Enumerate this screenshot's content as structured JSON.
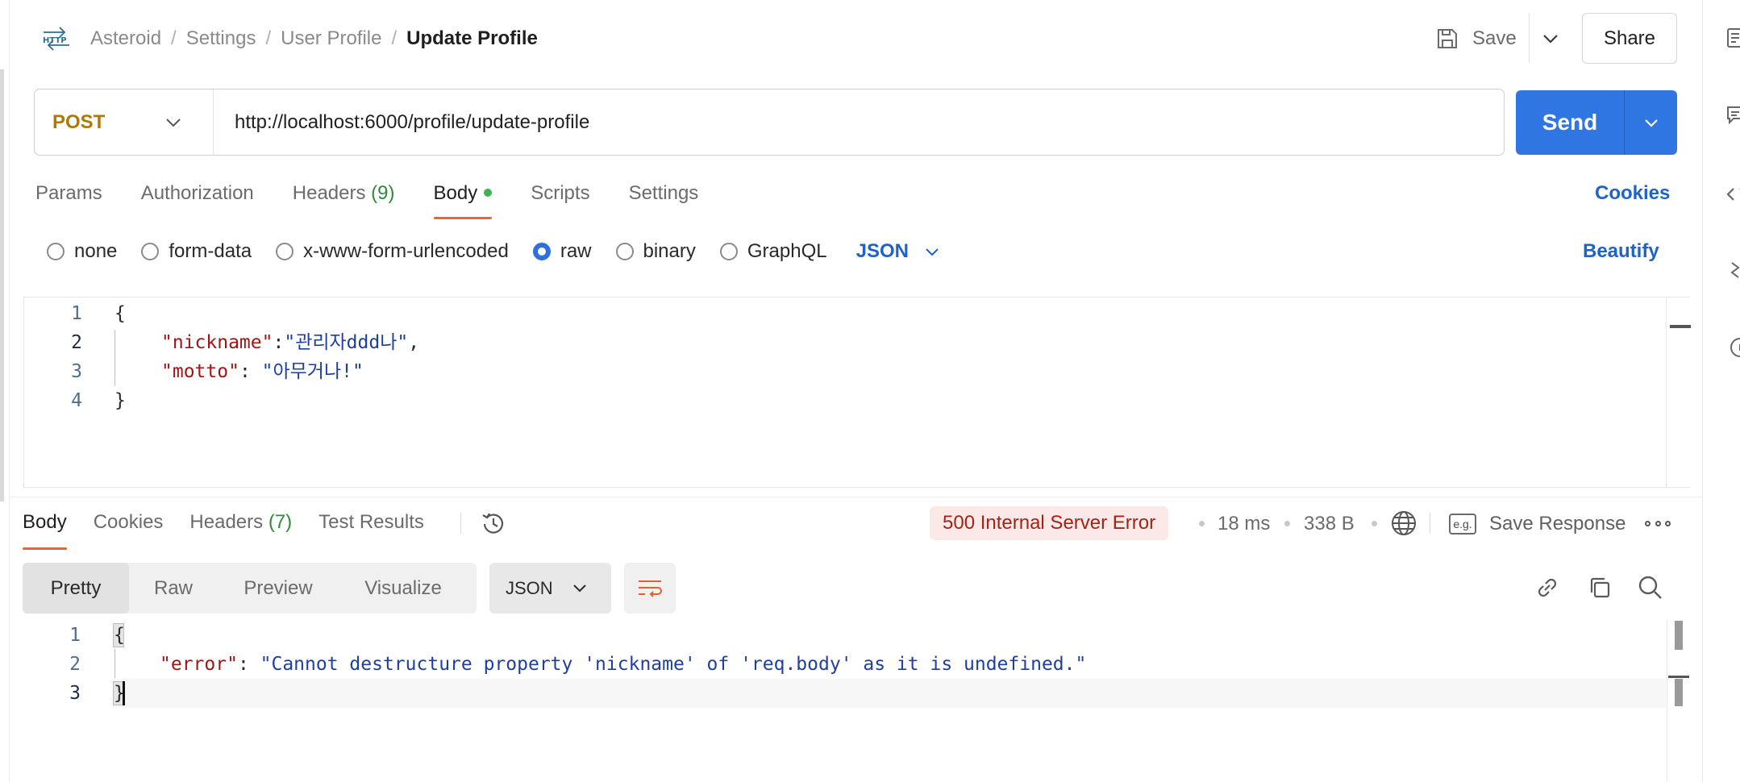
{
  "breadcrumb": {
    "items": [
      "Asteroid",
      "Settings",
      "User Profile"
    ],
    "current": "Update Profile"
  },
  "header": {
    "save_label": "Save",
    "share_label": "Share"
  },
  "request": {
    "method": "POST",
    "url": "http://localhost:6000/profile/update-profile",
    "send_label": "Send",
    "tabs": [
      {
        "label": "Params"
      },
      {
        "label": "Authorization"
      },
      {
        "label": "Headers",
        "count": "(9)"
      },
      {
        "label": "Body",
        "active": true
      },
      {
        "label": "Scripts"
      },
      {
        "label": "Settings"
      }
    ],
    "cookies_label": "Cookies",
    "body_types": [
      "none",
      "form-data",
      "x-www-form-urlencoded",
      "raw",
      "binary",
      "GraphQL"
    ],
    "selected_body_type": "raw",
    "format": "JSON",
    "beautify_label": "Beautify",
    "body_lines": {
      "n1": "1",
      "n2": "2",
      "n3": "3",
      "n4": "4",
      "open": "{",
      "k1": "\"nickname\"",
      "c1": ":",
      "v1": "\"관리자ddd나\"",
      "comma": ",",
      "k2": "\"motto\"",
      "c2": ": ",
      "v2": "\"아무거나!\"",
      "close": "}"
    }
  },
  "response": {
    "tabs": [
      {
        "label": "Body",
        "active": true
      },
      {
        "label": "Cookies"
      },
      {
        "label": "Headers",
        "count": "(7)"
      },
      {
        "label": "Test Results"
      }
    ],
    "status": "500 Internal Server Error",
    "time": "18 ms",
    "size": "338 B",
    "save_response_label": "Save Response",
    "eg_label": "e.g.",
    "view_modes": [
      "Pretty",
      "Raw",
      "Preview",
      "Visualize"
    ],
    "format": "JSON",
    "body_lines": {
      "n1": "1",
      "n2": "2",
      "n3": "3",
      "open": "{",
      "key": "\"error\"",
      "colon": ": ",
      "value": "\"Cannot destructure property 'nickname' of 'req.body' as it is undefined.\"",
      "close": "}"
    }
  },
  "colors": {
    "accent": "#2f76e2",
    "tab_underline": "#e8692b",
    "method_post": "#ad7a03",
    "status_error_bg": "#fbe9e7",
    "status_error_text": "#a3231a"
  }
}
